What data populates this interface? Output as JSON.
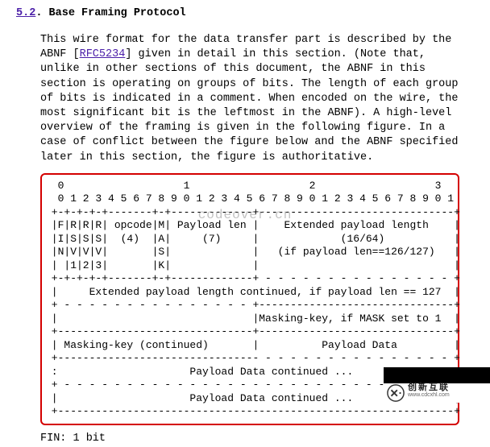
{
  "section": {
    "number": "5.2",
    "title": "Base Framing Protocol"
  },
  "paragraph": {
    "pre": "This wire format for the data transfer part is described by the ABNF [",
    "rfc": "RFC5234",
    "post": "] given in detail in this section.  (Note that, unlike in other sections of this document, the ABNF in this section is operating on groups of bits.  The length of each group of bits is indicated in a comment.  When encoded on the wire, the most significant bit is the leftmost in the ABNF).  A high-level overview of the framing is given in the following figure.  In a case of conflict between the figure below and the ABNF specified later in this section, the figure is authoritative."
  },
  "frame_ascii": "  0                   1                   2                   3\n  0 1 2 3 4 5 6 7 8 9 0 1 2 3 4 5 6 7 8 9 0 1 2 3 4 5 6 7 8 9 0 1\n +-+-+-+-+-------+-+-------------+-------------------------------+\n |F|R|R|R| opcode|M| Payload len |    Extended payload length    |\n |I|S|S|S|  (4)  |A|     (7)     |             (16/64)           |\n |N|V|V|V|       |S|             |   (if payload len==126/127)   |\n | |1|2|3|       |K|             |                               |\n +-+-+-+-+-------+-+-------------+ - - - - - - - - - - - - - - - +\n |     Extended payload length continued, if payload len == 127  |\n + - - - - - - - - - - - - - - - +-------------------------------+\n |                               |Masking-key, if MASK set to 1  |\n +-------------------------------+-------------------------------+\n | Masking-key (continued)       |          Payload Data         |\n +-------------------------------- - - - - - - - - - - - - - - - +\n :                     Payload Data continued ...                :\n + - - - - - - - - - - - - - - - - - - - - - - - - - - - - - - - +\n |                     Payload Data continued ...                |\n +---------------------------------------------------------------+",
  "def": {
    "fin_label": "FIN:  1 bit"
  },
  "watermark": "codeover.cn",
  "brand": {
    "cn": "创新互联",
    "en": "www.cdcxhl.com"
  }
}
